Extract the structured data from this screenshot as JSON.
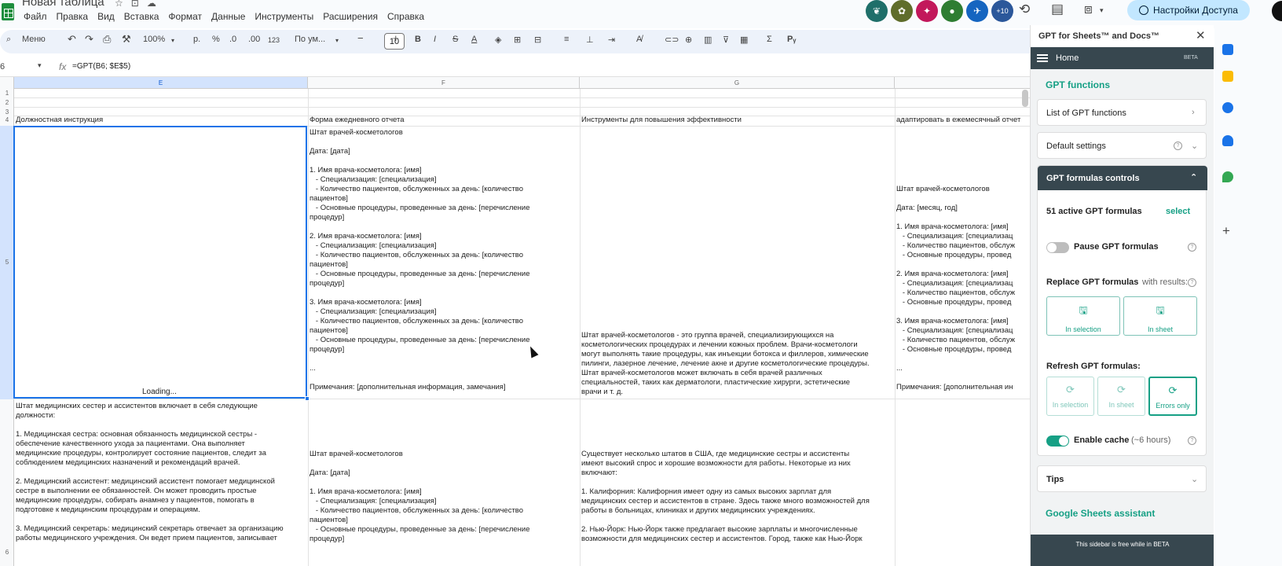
{
  "app": {
    "doc_title": "Новая таблица",
    "menu": [
      "Файл",
      "Правка",
      "Вид",
      "Вставка",
      "Формат",
      "Данные",
      "Инструменты",
      "Расширения",
      "Справка"
    ],
    "collaborators_extra": "+10",
    "share_label": "Настройки Доступа"
  },
  "toolbar": {
    "search_label": "Меню",
    "zoom": "100%",
    "currency": "р.",
    "percent": "%",
    "dec_decrease": ".0",
    "dec_increase": ".00",
    "number_format": "123",
    "font_name": "По ум...",
    "font_size": "10"
  },
  "formula_bar": {
    "cell_ref": "6",
    "formula": "=GPT(B6; $E$5)"
  },
  "grid": {
    "columns": [
      "E",
      "F",
      "G",
      ""
    ],
    "row_numbers": [
      "1",
      "2",
      "3",
      "4",
      "5",
      "6"
    ],
    "headers": {
      "e": "Должностная инструкция",
      "f": "Форма ежедневного отчета",
      "g": "Инструменты для повышения эффективности",
      "h": "адаптировать в ежемесячный отчет"
    },
    "loading": "Loading...",
    "f_row1": "Штат врачей-косметологов\n\nДата: [дата]\n\n1. Имя врача-косметолога: [имя]\n   - Специализация: [специализация]\n   - Количество пациентов, обслуженных за день: [количество\nпациентов]\n   - Основные процедуры, проведенные за день: [перечисление\nпроцедур]\n\n2. Имя врача-косметолога: [имя]\n   - Специализация: [специализация]\n   - Количество пациентов, обслуженных за день: [количество\nпациентов]\n   - Основные процедуры, проведенные за день: [перечисление\nпроцедур]\n\n3. Имя врача-косметолога: [имя]\n   - Специализация: [специализация]\n   - Количество пациентов, обслуженных за день: [количество\nпациентов]\n   - Основные процедуры, проведенные за день: [перечисление\nпроцедур]\n\n...\n\nПримечания: [дополнительная информация, замечания]",
    "g_row1": "Штат врачей-косметологов - это группа врачей, специализирующихся на\nкосметологических процедурах и лечении кожных проблем. Врачи-косметологи\nмогут выполнять такие процедуры, как инъекции ботокса и филлеров, химические\nпилинги, лазерное лечение, лечение акне и другие косметологические процедуры.\nШтат врачей-косметологов может включать в себя врачей различных\nспециальностей, таких как дерматологи, пластические хирурги, эстетические\nврачи и т. д.",
    "h_row1": "Штат врачей-косметологов\n\nДата: [месяц, год]\n\n1. Имя врача-косметолога: [имя]\n   - Специализация: [специализац\n   - Количество пациентов, обслуж\n   - Основные процедуры, провед\n\n2. Имя врача-косметолога: [имя]\n   - Специализация: [специализац\n   - Количество пациентов, обслуж\n   - Основные процедуры, провед\n\n3. Имя врача-косметолога: [имя]\n   - Специализация: [специализац\n   - Количество пациентов, обслуж\n   - Основные процедуры, провед\n\n...\n\nПримечания: [дополнительная ин",
    "e_row2": "Штат медицинских сестер и ассистентов включает в себя следующие\nдолжности:\n\n1. Медицинская сестра: основная обязанность медицинской сестры -\nобеспечение качественного ухода за пациентами. Она выполняет\nмедицинские процедуры, контролирует состояние пациентов, следит за\nсоблюдением медицинских назначений и рекомендаций врачей.\n\n2. Медицинский ассистент: медицинский ассистент помогает медицинской\nсестре в выполнении ее обязанностей. Он может проводить простые\nмедицинские процедуры, собирать анамнез у пациентов, помогать в\nподготовке к медицинским процедурам и операциям.\n\n3. Медицинский секретарь: медицинский секретарь отвечает за организацию\nработы медицинского учреждения. Он ведет прием пациентов, записывает",
    "f_row2": "Штат врачей-косметологов\n\nДата: [дата]\n\n1. Имя врача-косметолога: [имя]\n   - Специализация: [специализация]\n   - Количество пациентов, обслуженных за день: [количество\nпациентов]\n   - Основные процедуры, проведенные за день: [перечисление\nпроцедур]",
    "g_row2": "Существует несколько штатов в США, где медицинские сестры и ассистенты\nимеют высокий спрос и хорошие возможности для работы. Некоторые из них\nвключают:\n\n1. Калифорния: Калифорния имеет одну из самых высоких зарплат для\nмедицинских сестер и ассистентов в стране. Здесь также много возможностей для\nработы в больницах, клиниках и других медицинских учреждениях.\n\n2. Нью-Йорк: Нью-Йорк также предлагает высокие зарплаты и многочисленные\nвозможности для медицинских сестер и ассистентов. Город, также как Нью-Йорк"
  },
  "sidebar": {
    "title": "GPT for Sheets™ and Docs™",
    "nav_home": "Home",
    "nav_badge": "BETA",
    "section_functions": "GPT functions",
    "list_functions": "List of GPT functions",
    "default_settings": "Default settings",
    "controls_title": "GPT formulas controls",
    "active_count": "51 active GPT formulas",
    "select_link": "select",
    "pause_label": "Pause GPT formulas",
    "replace_label": "Replace GPT formulas",
    "replace_suffix": "with results:",
    "btn_in_selection": "In selection",
    "btn_in_sheet": "In sheet",
    "refresh_label": "Refresh GPT formulas:",
    "btn_errors_only": "Errors only",
    "cache_label": "Enable cache",
    "cache_suffix": "(~6 hours)",
    "tips": "Tips",
    "assistant": "Google Sheets assistant",
    "footer": "This sidebar is free while in BETA"
  },
  "colors": {
    "accent": "#16a085",
    "panel_dark": "#37474f",
    "selection": "#1a73e8"
  }
}
